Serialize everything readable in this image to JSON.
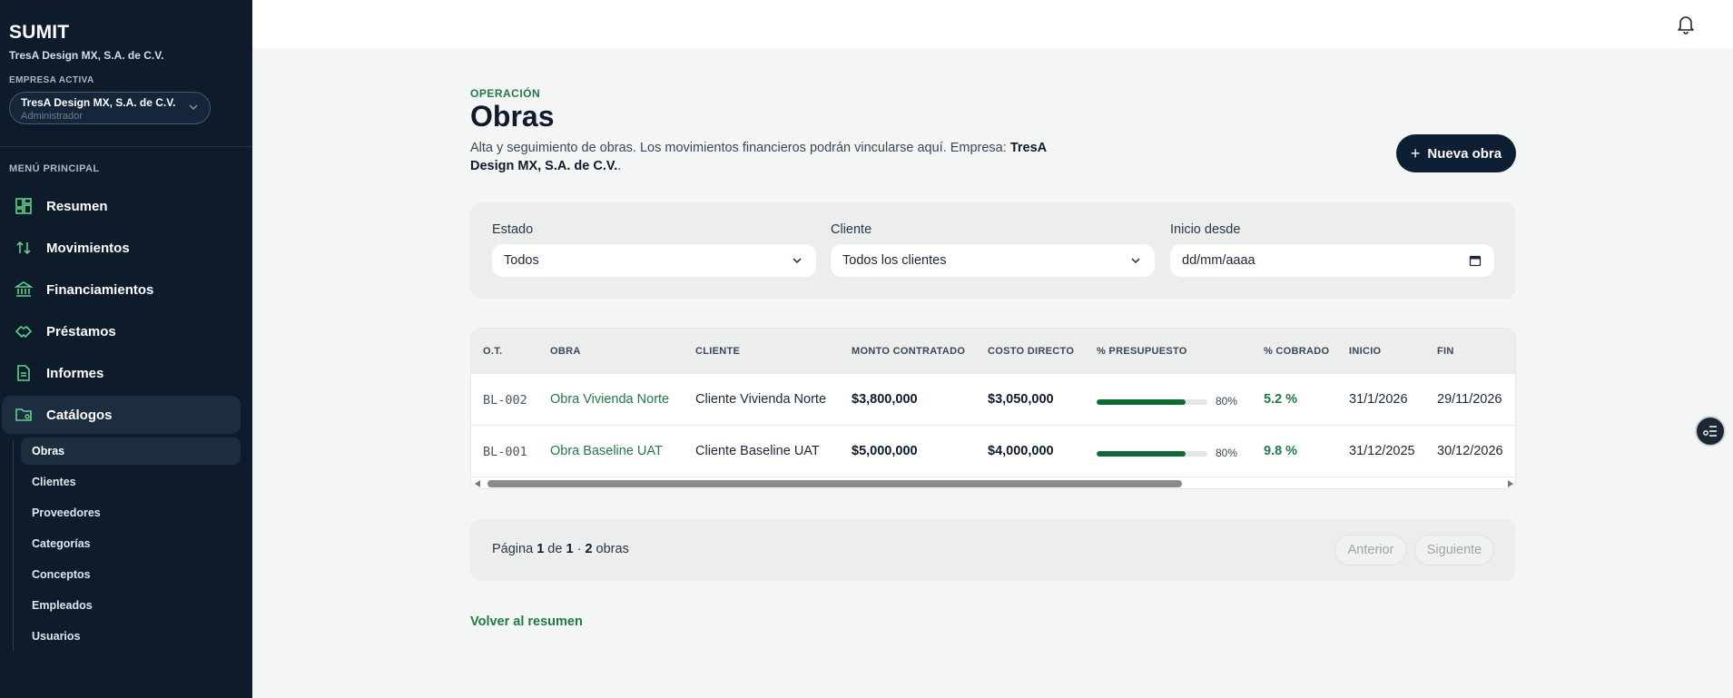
{
  "sidebar": {
    "brand": "SUMIT",
    "brand_subtitle": "TresA Design MX, S.A. de C.V.",
    "company_label": "EMPRESA ACTIVA",
    "company_select": {
      "name": "TresA Design MX, S.A. de C.V.",
      "role": "Administrador"
    },
    "menu_label": "MENÚ PRINCIPAL",
    "nav": [
      {
        "label": "Resumen",
        "icon": "dashboard-icon"
      },
      {
        "label": "Movimientos",
        "icon": "arrows-updown-icon"
      },
      {
        "label": "Financiamientos",
        "icon": "bank-icon"
      },
      {
        "label": "Préstamos",
        "icon": "handshake-icon"
      },
      {
        "label": "Informes",
        "icon": "document-icon"
      },
      {
        "label": "Catálogos",
        "icon": "folder-settings-icon"
      }
    ],
    "catalogs": [
      "Obras",
      "Clientes",
      "Proveedores",
      "Categorías",
      "Conceptos",
      "Empleados",
      "Usuarios"
    ]
  },
  "header": {
    "eyebrow": "OPERACIÓN",
    "title": "Obras",
    "description": "Alta y seguimiento de obras. Los movimientos financieros podrán vincularse aquí. Empresa:",
    "company": "TresA Design MX, S.A. de C.V.",
    "new_button": "Nueva obra"
  },
  "filters": {
    "estado": {
      "label": "Estado",
      "value": "Todos"
    },
    "cliente": {
      "label": "Cliente",
      "value": "Todos los clientes"
    },
    "inicio": {
      "label": "Inicio desde",
      "placeholder": "dd/mm/aaaa"
    }
  },
  "table": {
    "columns": [
      "O.T.",
      "OBRA",
      "CLIENTE",
      "MONTO CONTRATADO",
      "COSTO DIRECTO",
      "% PRESUPUESTO",
      "% COBRADO",
      "INICIO",
      "FIN"
    ],
    "rows": [
      {
        "ot": "BL-002",
        "obra": "Obra Vivienda Norte",
        "cliente": "Cliente Vivienda Norte",
        "monto": "$3,800,000",
        "costo": "$3,050,000",
        "presupuesto": "80%",
        "presupuesto_value": 80,
        "cobrado": "5.2 %",
        "inicio": "31/1/2026",
        "fin": "29/11/2026"
      },
      {
        "ot": "BL-001",
        "obra": "Obra Baseline UAT",
        "cliente": "Cliente Baseline UAT",
        "monto": "$5,000,000",
        "costo": "$4,000,000",
        "presupuesto": "80%",
        "presupuesto_value": 80,
        "cobrado": "9.8 %",
        "inicio": "31/12/2025",
        "fin": "30/12/2026"
      }
    ]
  },
  "pager": {
    "page_word": "Página",
    "page": "1",
    "of_word": "de",
    "total_pages": "1",
    "count": "2",
    "count_word": "obras",
    "prev": "Anterior",
    "next": "Siguiente"
  },
  "back_link": "Volver al resumen",
  "colors": {
    "sidebar": "#0d1b2a",
    "accent": "#1f7a45",
    "bar_fill": "#0f6b36"
  }
}
